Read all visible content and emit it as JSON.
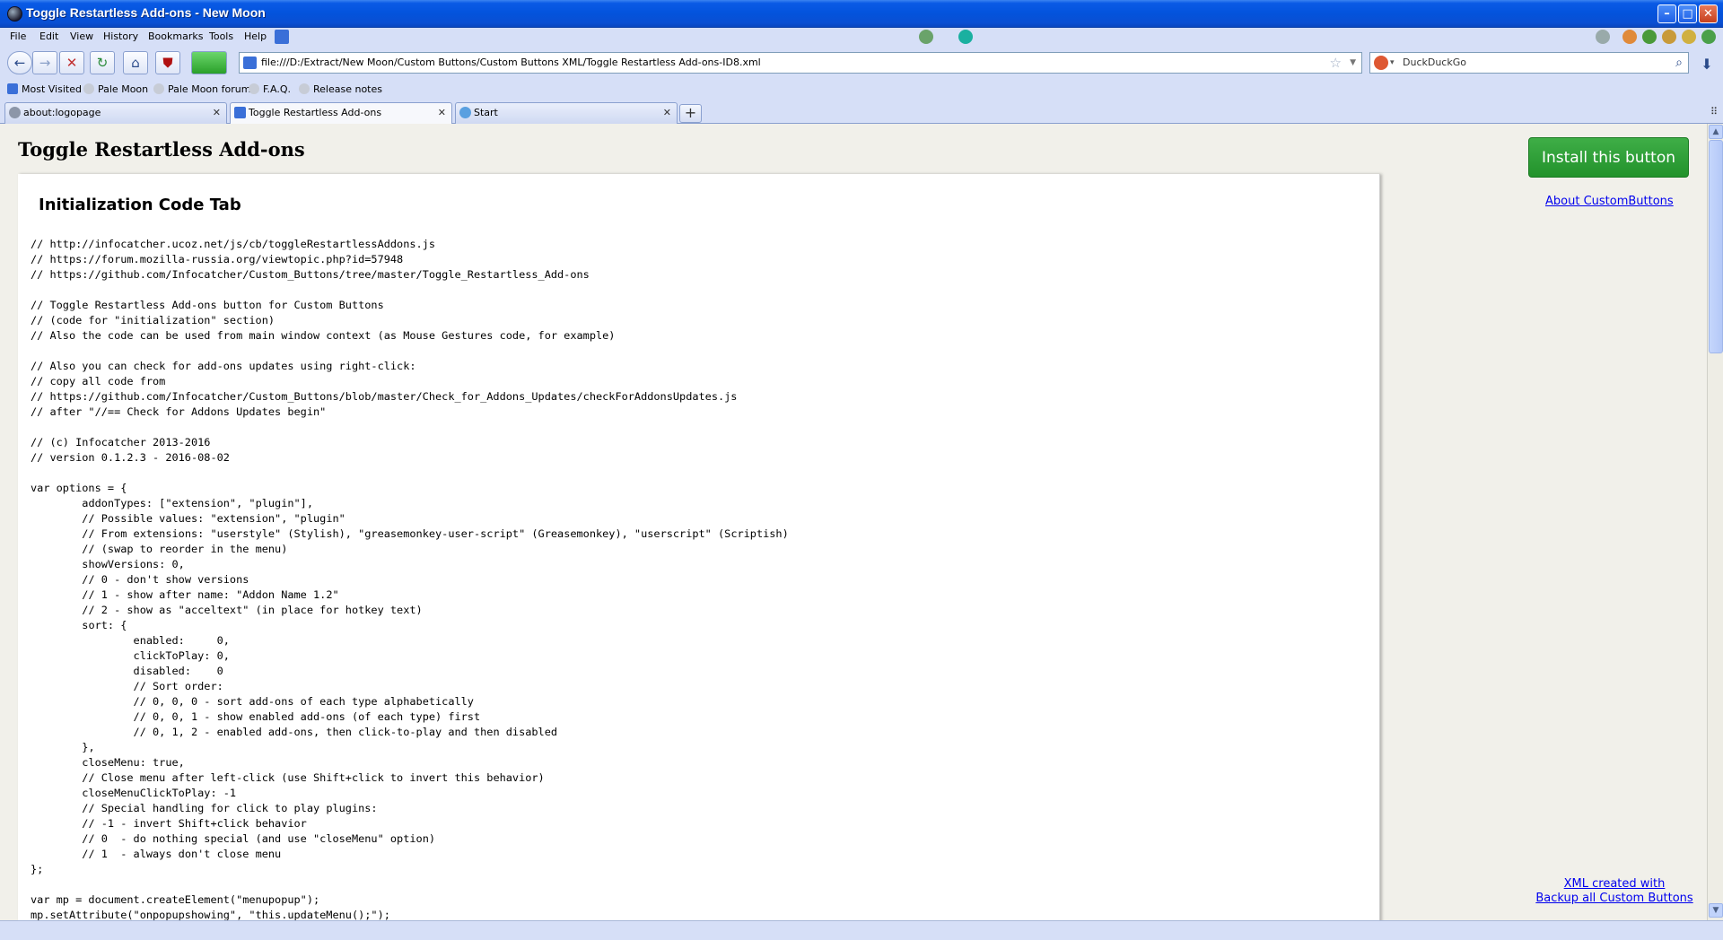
{
  "window": {
    "title": "Toggle Restartless Add-ons - New Moon"
  },
  "menu": {
    "items": [
      "File",
      "Edit",
      "View",
      "History",
      "Bookmarks",
      "Tools",
      "Help"
    ]
  },
  "navbar": {
    "url": "file:///D:/Extract/New Moon/Custom Buttons/Custom Buttons XML/Toggle Restartless Add-ons-ID8.xml",
    "search_engine": "DuckDuckGo"
  },
  "bookmarks": [
    "Most Visited",
    "Pale Moon",
    "Pale Moon forum",
    "F.A.Q.",
    "Release notes"
  ],
  "tabs": [
    {
      "label": "about:logopage"
    },
    {
      "label": "Toggle Restartless Add-ons"
    },
    {
      "label": "Start"
    }
  ],
  "page": {
    "title": "Toggle Restartless Add-ons",
    "section_title": "Initialization Code Tab",
    "install_label": "Install this button",
    "about_link": "About CustomButtons",
    "xml_created_line1": "XML created with",
    "xml_created_line2": "Backup all Custom Buttons",
    "code": "// http://infocatcher.ucoz.net/js/cb/toggleRestartlessAddons.js\n// https://forum.mozilla-russia.org/viewtopic.php?id=57948\n// https://github.com/Infocatcher/Custom_Buttons/tree/master/Toggle_Restartless_Add-ons\n\n// Toggle Restartless Add-ons button for Custom Buttons\n// (code for \"initialization\" section)\n// Also the code can be used from main window context (as Mouse Gestures code, for example)\n\n// Also you can check for add-ons updates using right-click:\n// copy all code from\n// https://github.com/Infocatcher/Custom_Buttons/blob/master/Check_for_Addons_Updates/checkForAddonsUpdates.js\n// after \"//== Check for Addons Updates begin\"\n\n// (c) Infocatcher 2013-2016\n// version 0.1.2.3 - 2016-08-02\n\nvar options = {\n\taddonTypes: [\"extension\", \"plugin\"],\n\t// Possible values: \"extension\", \"plugin\"\n\t// From extensions: \"userstyle\" (Stylish), \"greasemonkey-user-script\" (Greasemonkey), \"userscript\" (Scriptish)\n\t// (swap to reorder in the menu)\n\tshowVersions: 0,\n\t// 0 - don't show versions\n\t// 1 - show after name: \"Addon Name 1.2\"\n\t// 2 - show as \"acceltext\" (in place for hotkey text)\n\tsort: {\n\t\tenabled:     0,\n\t\tclickToPlay: 0,\n\t\tdisabled:    0\n\t\t// Sort order:\n\t\t// 0, 0, 0 - sort add-ons of each type alphabetically\n\t\t// 0, 0, 1 - show enabled add-ons (of each type) first\n\t\t// 0, 1, 2 - enabled add-ons, then click-to-play and then disabled\n\t},\n\tcloseMenu: true,\n\t// Close menu after left-click (use Shift+click to invert this behavior)\n\tcloseMenuClickToPlay: -1\n\t// Special handling for click to play plugins:\n\t// -1 - invert Shift+click behavior\n\t// 0  - do nothing special (and use \"closeMenu\" option)\n\t// 1  - always don't close menu\n};\n\nvar mp = document.createElement(\"menupopup\");\nmp.setAttribute(\"onpopupshowing\", \"this.updateMenu();\");"
  }
}
